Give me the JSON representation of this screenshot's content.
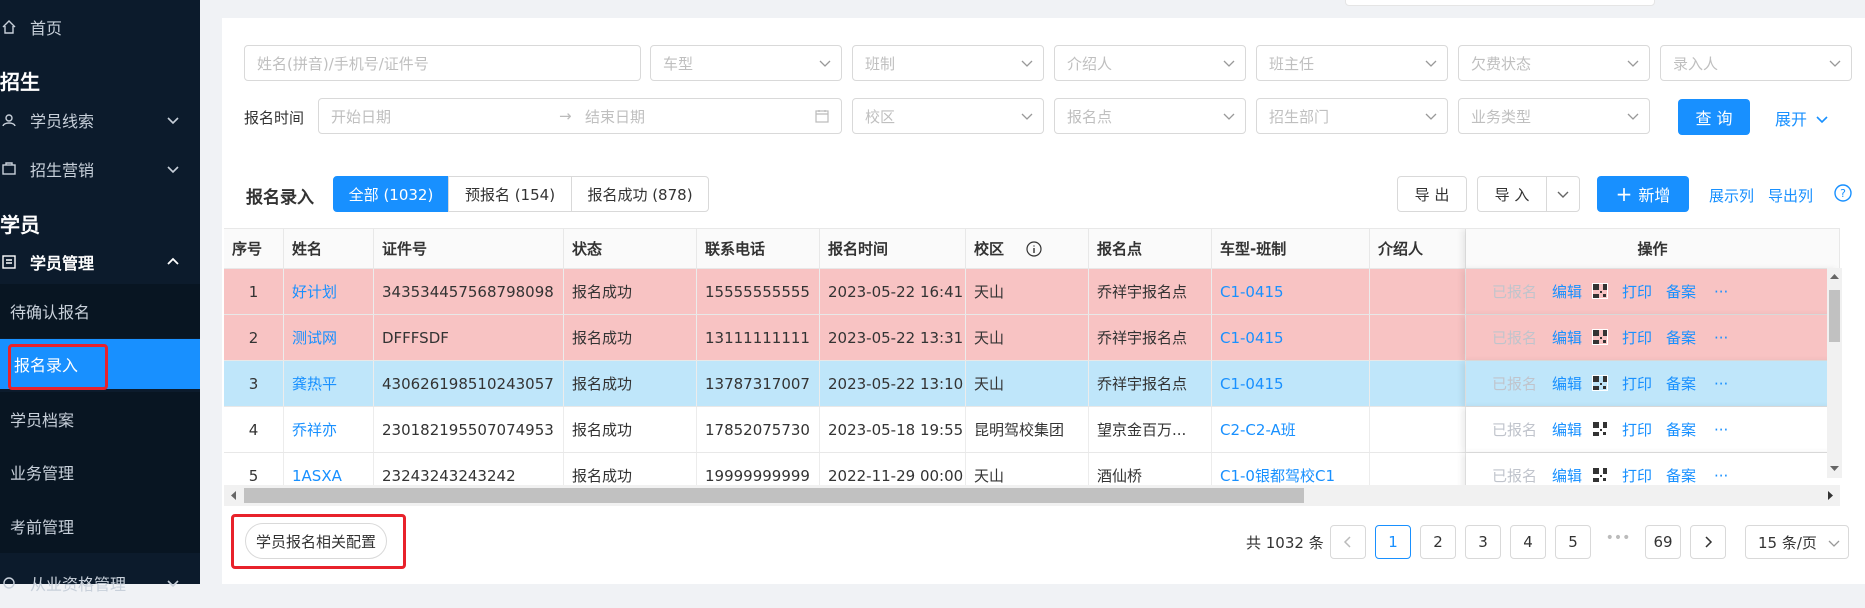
{
  "sidebar": {
    "home": "首页",
    "group_recruit": "招生",
    "student_leads": "学员线索",
    "recruit_marketing": "招生营销",
    "group_student": "学员",
    "student_mgmt": "学员管理",
    "sub_items": [
      "待确认报名",
      "报名录入",
      "学员档案",
      "业务管理",
      "考前管理"
    ],
    "bottom_item": "从业资格管理"
  },
  "filters": {
    "row1": [
      {
        "placeholder": "姓名(拼音)/手机号/证件号"
      },
      {
        "placeholder": "车型"
      },
      {
        "placeholder": "班制"
      },
      {
        "placeholder": "介绍人"
      },
      {
        "placeholder": "班主任"
      },
      {
        "placeholder": "欠费状态"
      },
      {
        "placeholder": "录入人"
      }
    ],
    "date_label": "报名时间",
    "start_date": "开始日期",
    "end_date": "结束日期",
    "date_sep": "→",
    "row2": [
      {
        "placeholder": "校区"
      },
      {
        "placeholder": "报名点"
      },
      {
        "placeholder": "招生部门"
      },
      {
        "placeholder": "业务类型"
      }
    ],
    "query_btn": "查 询",
    "expand": "展开"
  },
  "table_header": {
    "title": "报名录入",
    "tabs": [
      "全部 (1032)",
      "预报名 (154)",
      "报名成功 (878)"
    ],
    "export": "导 出",
    "import": "导 入",
    "add": "新增",
    "show_cols": "展示列",
    "export_cols": "导出列"
  },
  "columns": [
    "序号",
    "姓名",
    "证件号",
    "状态",
    "联系电话",
    "报名时间",
    "校区",
    "报名点",
    "车型-班制",
    "介绍人",
    "操作"
  ],
  "rows": [
    {
      "no": "1",
      "name": "好计划",
      "id": "343534457568798098",
      "status": "报名成功",
      "phone": "15555555555",
      "time": "2023-05-22 16:41",
      "campus": "天山",
      "point": "乔祥宇报名点",
      "class": "C1-0415",
      "bg": "#f8c3c3"
    },
    {
      "no": "2",
      "name": "测试网",
      "id": "DFFFSDF",
      "status": "报名成功",
      "phone": "13111111111",
      "time": "2023-05-22 13:31",
      "campus": "天山",
      "point": "乔祥宇报名点",
      "class": "C1-0415",
      "bg": "#f8c3c3"
    },
    {
      "no": "3",
      "name": "龚热平",
      "id": "430626198510243057",
      "status": "报名成功",
      "phone": "13787317007",
      "time": "2023-05-22 13:10",
      "campus": "天山",
      "point": "乔祥宇报名点",
      "class": "C1-0415",
      "bg": "#bfe6fa"
    },
    {
      "no": "4",
      "name": "乔祥亦",
      "id": "230182195507074953",
      "status": "报名成功",
      "phone": "17852075730",
      "time": "2023-05-18 19:55",
      "campus": "昆明驾校集团",
      "point": "望京金百万...",
      "class": "C2-C2-A班",
      "bg": "#ffffff"
    },
    {
      "no": "5",
      "name": "1ASXA",
      "id": "23243243243242",
      "status": "报名成功",
      "phone": "19999999999",
      "time": "2022-11-29 00:00",
      "campus": "天山",
      "point": "酒仙桥",
      "class": "C1-0银都驾校C1",
      "bg": "#ffffff"
    }
  ],
  "row_ops": {
    "registered": "已报名",
    "edit": "编辑",
    "print": "打印",
    "record": "备案",
    "more": "···"
  },
  "footer": {
    "config_btn": "学员报名相关配置",
    "total": "共 1032 条",
    "pages": [
      "1",
      "2",
      "3",
      "4",
      "5"
    ],
    "ellipsis": "•••",
    "last_page": "69",
    "page_size": "15 条/页"
  },
  "colors": {
    "accent": "#1890ff",
    "sidebar_bg": "#0c1b2c",
    "row_pink": "#f8c3c3",
    "row_blue": "#bfe6fa",
    "highlight_red": "#e8222b"
  }
}
